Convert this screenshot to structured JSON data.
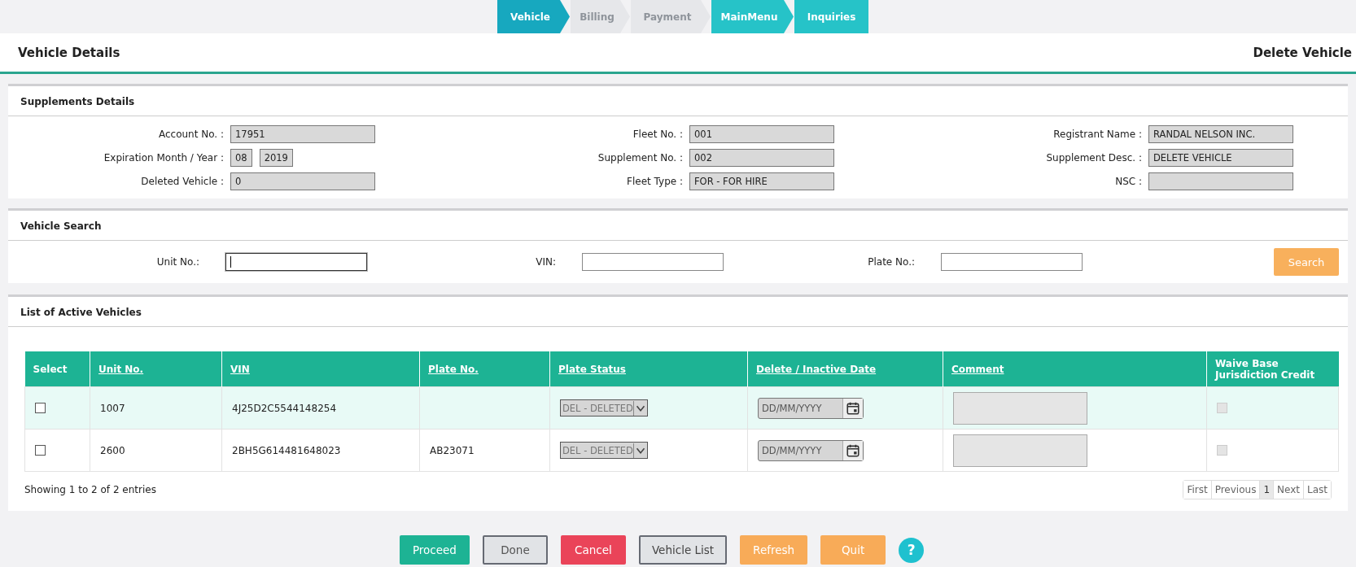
{
  "steps": [
    {
      "label": "Vehicle",
      "selected": true,
      "disabled": false
    },
    {
      "label": "Billing",
      "selected": false,
      "disabled": true
    },
    {
      "label": "Payment",
      "selected": false,
      "disabled": true
    },
    {
      "label": "MainMenu",
      "selected": false,
      "disabled": false
    },
    {
      "label": "Inquiries",
      "selected": false,
      "disabled": false
    }
  ],
  "header": {
    "title": "Vehicle Details",
    "action": "Delete Vehicle"
  },
  "supplements": {
    "title": "Supplements Details",
    "fields": [
      {
        "label": "Account No. :",
        "values": [
          "17951"
        ]
      },
      {
        "label": "Fleet No. :",
        "values": [
          "001"
        ]
      },
      {
        "label": "Registrant Name :",
        "values": [
          "RANDAL NELSON INC."
        ]
      },
      {
        "label": "Expiration Month / Year :",
        "values": [
          "08",
          "2019"
        ]
      },
      {
        "label": "Supplement No. :",
        "values": [
          "002"
        ]
      },
      {
        "label": "Supplement Desc. :",
        "values": [
          "DELETE VEHICLE"
        ]
      },
      {
        "label": "Deleted Vehicle :",
        "values": [
          "0"
        ]
      },
      {
        "label": "Fleet Type :",
        "values": [
          "FOR - FOR HIRE"
        ]
      },
      {
        "label": "NSC :"
      }
    ]
  },
  "search": {
    "title": "Vehicle Search",
    "fields": [
      {
        "label": "Unit No.:",
        "focused": true
      },
      {
        "label": "VIN:",
        "focused": false
      },
      {
        "label": "Plate No.:",
        "focused": false
      }
    ],
    "button": "Search"
  },
  "vehicles": {
    "title": "List of Active Vehicles",
    "columns": [
      "Select",
      "Unit No.",
      "VIN",
      "Plate No.",
      "Plate Status",
      "Delete / Inactive Date",
      "Comment",
      "Waive Base Jurisdiction Credit"
    ],
    "rows": [
      {
        "checked": false,
        "unit": "1007",
        "vin": "4J25D2C5544148254",
        "plate": "",
        "status": "DEL - DELETED",
        "date_placeholder": "DD/MM/YYYY",
        "waive": false
      },
      {
        "checked": false,
        "unit": "2600",
        "vin": "2BH5G614481648023",
        "plate": "AB23071",
        "status": "DEL - DELETED",
        "date_placeholder": "DD/MM/YYYY",
        "waive": false
      }
    ],
    "info": "Showing 1 to 2 of 2 entries",
    "pages": [
      {
        "label": "First",
        "selected": false
      },
      {
        "label": "Previous",
        "selected": false
      },
      {
        "label": "1",
        "selected": true
      },
      {
        "label": "Next",
        "selected": false
      },
      {
        "label": "Last",
        "selected": false
      }
    ]
  },
  "buttons": [
    {
      "label": "Proceed",
      "kind": "primary"
    },
    {
      "label": "Done",
      "kind": "disabled"
    },
    {
      "label": "Cancel",
      "kind": "danger"
    },
    {
      "label": "Vehicle List",
      "kind": "outline"
    },
    {
      "label": "Refresh",
      "kind": "warning"
    },
    {
      "label": "Quit",
      "kind": "warning"
    }
  ],
  "help": "?"
}
